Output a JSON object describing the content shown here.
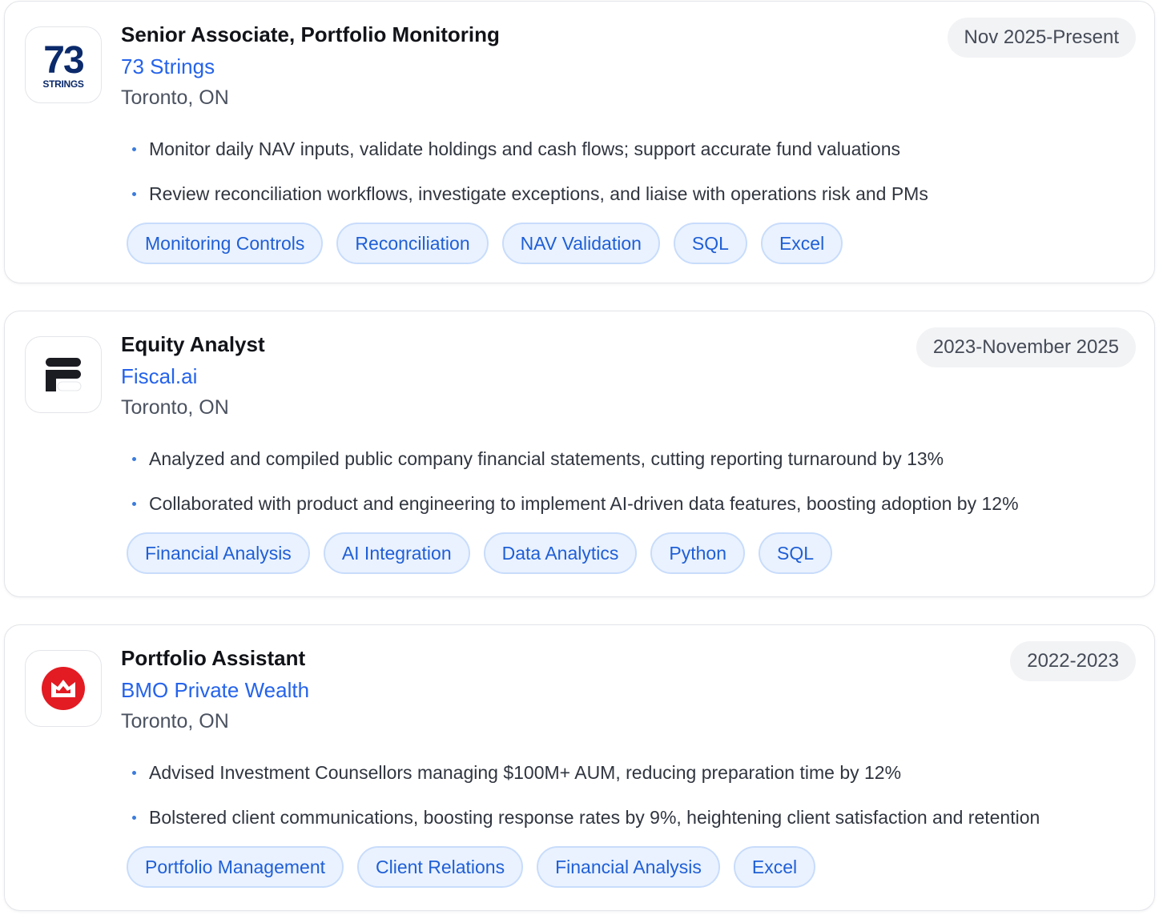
{
  "experiences": [
    {
      "logo": {
        "icon": "73-strings-logo",
        "number": "73",
        "sub": "STRINGS"
      },
      "title": "Senior Associate, Portfolio Monitoring",
      "company": "73 Strings",
      "location": "Toronto, ON",
      "dates": "Nov 2025-Present",
      "bullets": [
        "Monitor daily NAV inputs, validate holdings and cash flows; support accurate fund valuations",
        "Review reconciliation workflows, investigate exceptions, and liaise with operations risk and PMs"
      ],
      "tags": [
        "Monitoring Controls",
        "Reconciliation",
        "NAV Validation",
        "SQL",
        "Excel"
      ]
    },
    {
      "logo": {
        "icon": "fiscal-ai-logo"
      },
      "title": "Equity Analyst",
      "company": "Fiscal.ai",
      "location": "Toronto, ON",
      "dates": "2023-November 2025",
      "bullets": [
        "Analyzed and compiled public company financial statements, cutting reporting turnaround by 13%",
        "Collaborated with product and engineering to implement AI-driven data features, boosting adoption by 12%"
      ],
      "tags": [
        "Financial Analysis",
        "AI Integration",
        "Data Analytics",
        "Python",
        "SQL"
      ]
    },
    {
      "logo": {
        "icon": "bmo-logo"
      },
      "title": "Portfolio Assistant",
      "company": "BMO Private Wealth",
      "location": "Toronto, ON",
      "dates": "2022-2023",
      "bullets": [
        "Advised Investment Counsellors managing $100M+ AUM, reducing preparation time by 12%",
        "Bolstered client communications, boosting response rates by 9%, heightening client satisfaction and retention"
      ],
      "tags": [
        "Portfolio Management",
        "Client Relations",
        "Financial Analysis",
        "Excel"
      ]
    }
  ],
  "colors": {
    "accent": "#2563eb",
    "tag_bg": "#eaf2ff",
    "tag_border": "#c8dcfb",
    "bmo_red": "#e31b23",
    "strings_navy": "#0b2a6b"
  }
}
